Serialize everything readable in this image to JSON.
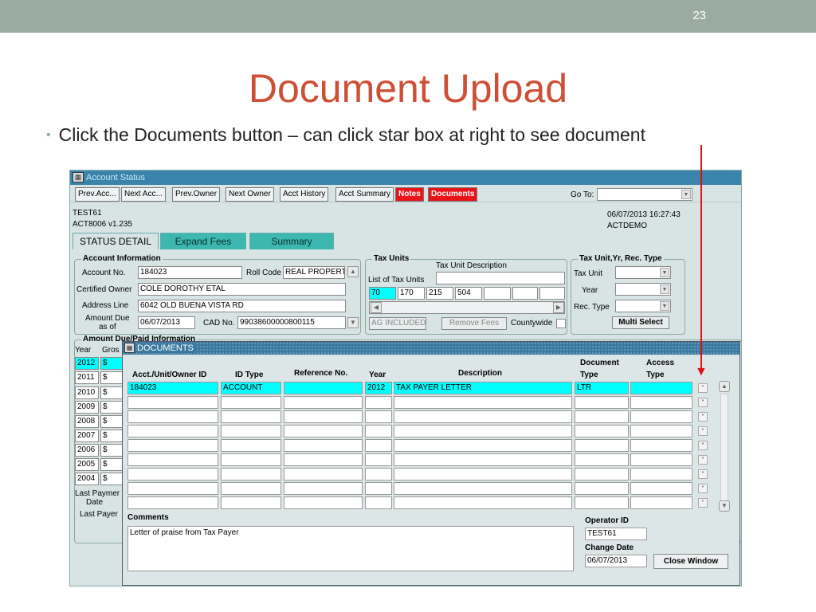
{
  "slide": {
    "number": "23",
    "title": "Document Upload",
    "bullet": "Click the Documents button – can click star box at right to see document"
  },
  "app": {
    "window_title": "Account Status",
    "toolbar": {
      "prev_acc": "Prev.Acc...",
      "next_acc": "Next Acc...",
      "prev_owner": "Prev.Owner",
      "next_owner": "Next Owner",
      "acct_history": "Acct History",
      "acct_summary": "Acct Summary",
      "notes": "Notes",
      "documents": "Documents",
      "goto_label": "Go To:"
    },
    "user_info": {
      "user": "TEST61",
      "version": "ACT8006    v1.235",
      "datetime": "06/07/2013 16:27:43",
      "db": "ACTDEMO"
    },
    "tabs": [
      "STATUS DETAIL",
      "Expand Fees",
      "Summary"
    ],
    "account": {
      "legend": "Account Information",
      "account_no_label": "Account No.",
      "account_no": "184023",
      "roll_code_label": "Roll Code",
      "roll_code": "REAL PROPERT",
      "certified_owner_label": "Certified Owner",
      "certified_owner": "COLE DOROTHY ETAL",
      "address_label": "Address Line",
      "address": "6042 OLD BUENA VISTA RD",
      "amount_due_label": "Amount Due",
      "as_of_label": "as of",
      "amount_due_date": "06/07/2013",
      "cad_label": "CAD No.",
      "cad_no": "99038600000800115"
    },
    "tax_units": {
      "legend": "Tax Units",
      "desc_label": "Tax Unit Description",
      "list_label": "List of Tax Units",
      "units": [
        "70",
        "170",
        "215",
        "504"
      ],
      "ag": "AG INCLUDED",
      "remove_fees": "Remove Fees",
      "countywide": "Countywide"
    },
    "tax_unit_year": {
      "legend": "Tax Unit,Yr, Rec. Type",
      "tax_unit_label": "Tax Unit",
      "year_label": "Year",
      "rec_type_label": "Rec. Type",
      "multi_select": "Multi Select"
    },
    "amount_section": {
      "legend": "Amount Due/Paid Information",
      "year_col": "Year",
      "gross_col": "Gros",
      "years": [
        "2012",
        "2011",
        "2010",
        "2009",
        "2008",
        "2007",
        "2006",
        "2005",
        "2004"
      ],
      "dollar": "$",
      "last_payment_date_label": "Last Paymer",
      "date_label": "Date",
      "last_payer_label": "Last Payer"
    }
  },
  "documents": {
    "title": "DOCUMENTS",
    "headers": {
      "acct": "Acct./Unit/Owner ID",
      "id_type": "ID Type",
      "ref_no": "Reference No.",
      "year": "Year",
      "description": "Description",
      "doc_type_1": "Document",
      "doc_type_2": "Type",
      "access_1": "Access",
      "access_2": "Type"
    },
    "row": {
      "acct": "184023",
      "id_type": "ACCOUNT",
      "ref_no": "",
      "year": "2012",
      "description": "TAX PAYER LETTER",
      "doc_type": "LTR",
      "access": ""
    },
    "comments_label": "Comments",
    "comments": "Letter of praise from Tax Payer",
    "operator_label": "Operator ID",
    "operator": "TEST61",
    "change_date_label": "Change Date",
    "change_date": "06/07/2013",
    "close_button": "Close Window"
  },
  "colors": {
    "title": "#cd4f35",
    "topbar": "#9aaca2",
    "highlight": "#00ffff",
    "red_button": "#e8141a"
  }
}
